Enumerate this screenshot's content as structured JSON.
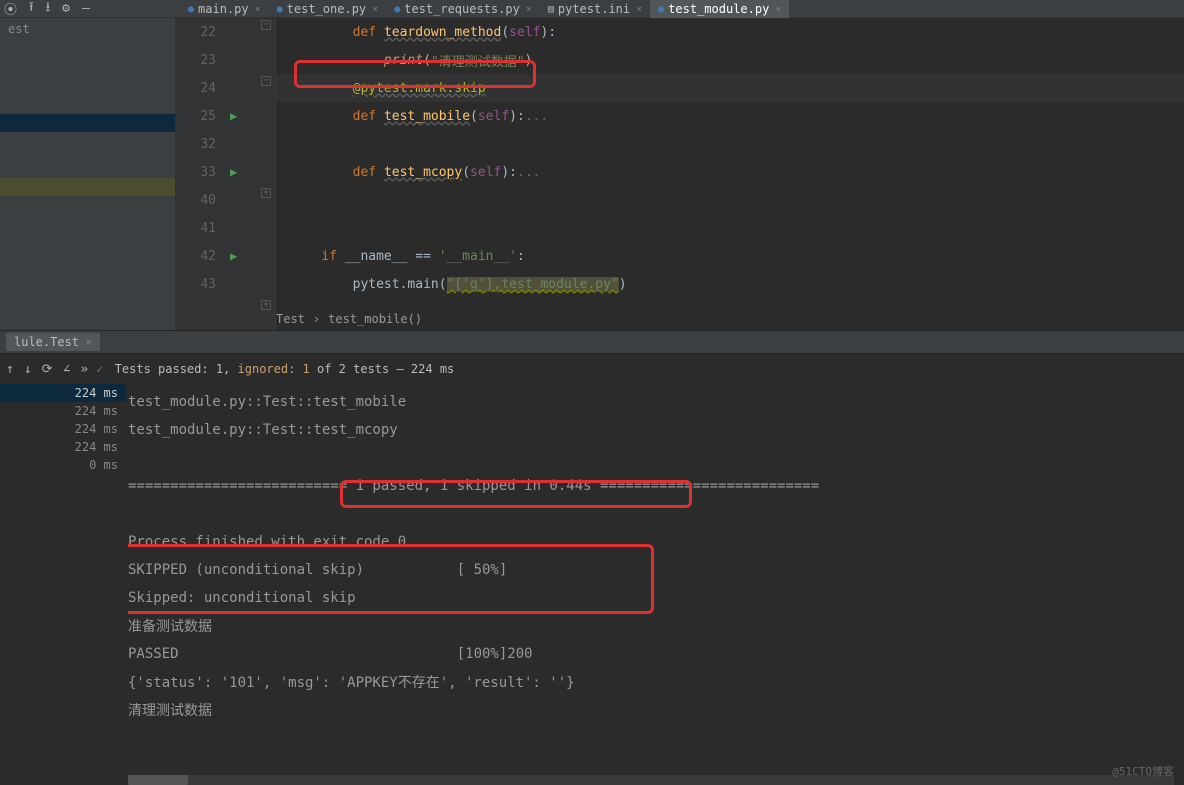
{
  "toolbar_icons": [
    "globe",
    "upload",
    "download",
    "gear",
    "minus"
  ],
  "tabs": [
    {
      "label": "main.py",
      "active": false
    },
    {
      "label": "test_one.py",
      "active": false
    },
    {
      "label": "test_requests.py",
      "active": false
    },
    {
      "label": "pytest.ini",
      "active": false,
      "icon": "ini"
    },
    {
      "label": "test_module.py",
      "active": true
    }
  ],
  "sidebar": {
    "label": "est"
  },
  "code": {
    "line22": {
      "no": "22",
      "indent": "        ",
      "text": "def teardown_method(self):"
    },
    "line23": {
      "no": "23",
      "indent": "            ",
      "call": "print",
      "arg": "\"清理测试数据\""
    },
    "line24": {
      "no": "24",
      "indent": "        ",
      "decor": "@pytest.mark.skip"
    },
    "line25": {
      "no": "25",
      "indent": "        ",
      "func": "test_mobile",
      "self": "self",
      "dots": "..."
    },
    "line32": {
      "no": "32"
    },
    "line33": {
      "no": "33",
      "indent": "        ",
      "func": "test_mcopy",
      "self": "self",
      "dots": "..."
    },
    "line40": {
      "no": "40"
    },
    "line41": {
      "no": "41"
    },
    "line42": {
      "no": "42",
      "indent": "    ",
      "text": "if __name__ == '__main__':"
    },
    "line43": {
      "no": "43",
      "indent": "        ",
      "call": "pytest.main",
      "warn": "\"['q'],test_module.py\""
    }
  },
  "breadcrumb": {
    "a": "Test",
    "b": "test_mobile()"
  },
  "tool_tab": "lule.Test",
  "run_status": {
    "prefix": "Tests passed: 1,",
    "ignored": " ignored: 1 ",
    "suffix": "of 2 tests – 224 ms"
  },
  "tree": [
    "224 ms",
    "224 ms",
    "224 ms",
    "224 ms",
    "0 ms"
  ],
  "console": {
    "l1": "test_module.py::Test::test_mobile",
    "l2": "test_module.py::Test::test_mcopy",
    "l3": "",
    "l4": "========================== 1 passed, 1 skipped in 0.44s ==========================",
    "l5": "",
    "l6": "Process finished with exit code 0",
    "l7": "SKIPPED (unconditional skip)           [ 50%]",
    "l8": "Skipped: unconditional skip",
    "l9": "准备测试数据",
    "l10": "PASSED                                 [100%]200",
    "l11": "{'status': '101', 'msg': 'APPKEY不存在', 'result': ''}",
    "l12": "清理测试数据"
  },
  "watermark": "@51CTO博客"
}
